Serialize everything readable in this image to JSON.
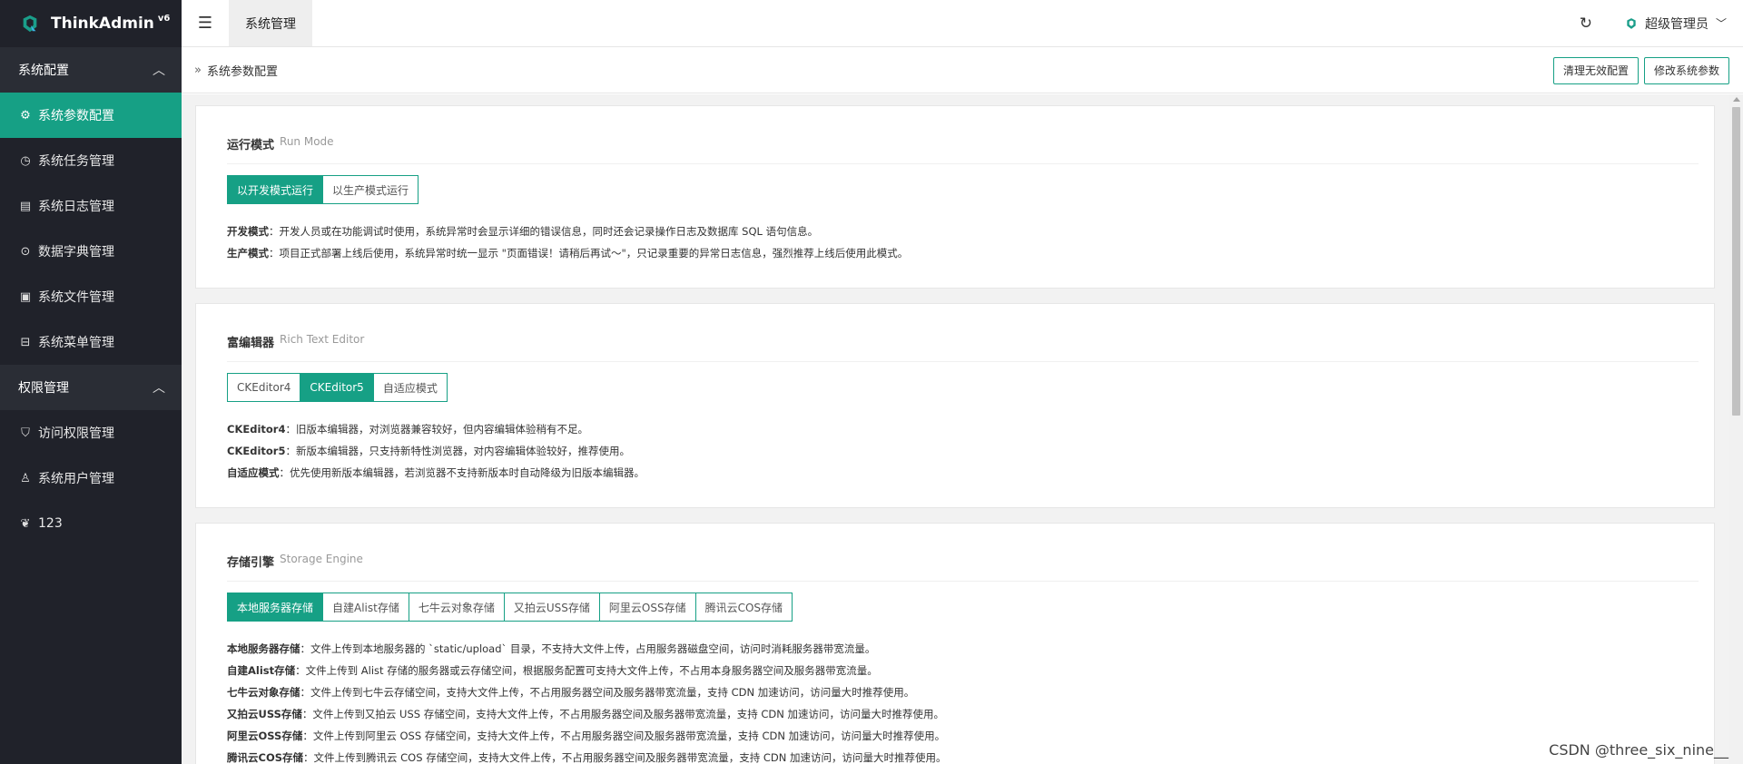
{
  "app": {
    "name": "ThinkAdmin",
    "version": "v6"
  },
  "sidebar": {
    "groups": [
      {
        "title": "系统配置",
        "items": [
          {
            "label": "系统参数配置",
            "icon": "gear-icon",
            "active": true
          },
          {
            "label": "系统任务管理",
            "icon": "clock-icon"
          },
          {
            "label": "系统日志管理",
            "icon": "log-icon"
          },
          {
            "label": "数据字典管理",
            "icon": "dictionary-icon"
          },
          {
            "label": "系统文件管理",
            "icon": "image-icon"
          },
          {
            "label": "系统菜单管理",
            "icon": "menu-icon"
          }
        ]
      },
      {
        "title": "权限管理",
        "items": [
          {
            "label": "访问权限管理",
            "icon": "shield-icon"
          },
          {
            "label": "系统用户管理",
            "icon": "user-icon"
          },
          {
            "label": "123",
            "icon": "leaf-icon"
          }
        ]
      }
    ]
  },
  "topbar": {
    "tab_label": "系统管理",
    "user_name": "超级管理员"
  },
  "breadcrumb": {
    "title": "系统参数配置",
    "actions": [
      "清理无效配置",
      "修改系统参数"
    ]
  },
  "sections": {
    "run_mode": {
      "title": "运行模式",
      "subtitle": "Run Mode",
      "options": [
        "以开发模式运行",
        "以生产模式运行"
      ],
      "selected": "以开发模式运行",
      "desc": [
        {
          "label": "开发模式",
          "text": "：开发人员或在功能调试时使用，系统异常时会显示详细的错误信息，同时还会记录操作日志及数据库 SQL 语句信息。"
        },
        {
          "label": "生产模式",
          "text": "：项目正式部署上线后使用，系统异常时统一显示 \"页面错误！请稍后再试～\"，只记录重要的异常日志信息，强烈推荐上线后使用此模式。"
        }
      ]
    },
    "editor": {
      "title": "富编辑器",
      "subtitle": "Rich Text Editor",
      "options": [
        "CKEditor4",
        "CKEditor5",
        "自适应模式"
      ],
      "selected": "CKEditor5",
      "desc": [
        {
          "label": "CKEditor4",
          "text": "：旧版本编辑器，对浏览器兼容较好，但内容编辑体验稍有不足。"
        },
        {
          "label": "CKEditor5",
          "text": "：新版本编辑器，只支持新特性浏览器，对内容编辑体验较好，推荐使用。"
        },
        {
          "label": "自适应模式",
          "text": "：优先使用新版本编辑器，若浏览器不支持新版本时自动降级为旧版本编辑器。"
        }
      ]
    },
    "storage": {
      "title": "存储引擎",
      "subtitle": "Storage Engine",
      "options": [
        "本地服务器存储",
        "自建Alist存储",
        "七牛云对象存储",
        "又拍云USS存储",
        "阿里云OSS存储",
        "腾讯云COS存储"
      ],
      "selected": "本地服务器存储",
      "desc": [
        {
          "label": "本地服务器存储",
          "text": "：文件上传到本地服务器的 `static/upload` 目录，不支持大文件上传，占用服务器磁盘空间，访问时消耗服务器带宽流量。"
        },
        {
          "label": "自建Alist存储",
          "text": "：文件上传到 Alist 存储的服务器或云存储空间，根据服务配置可支持大文件上传，不占用本身服务器空间及服务器带宽流量。"
        },
        {
          "label": "七牛云对象存储",
          "text": "：文件上传到七牛云存储空间，支持大文件上传，不占用服务器空间及服务器带宽流量，支持 CDN 加速访问，访问量大时推荐使用。"
        },
        {
          "label": "又拍云USS存储",
          "text": "：文件上传到又拍云 USS 存储空间，支持大文件上传，不占用服务器空间及服务器带宽流量，支持 CDN 加速访问，访问量大时推荐使用。"
        },
        {
          "label": "阿里云OSS存储",
          "text": "：文件上传到阿里云 OSS 存储空间，支持大文件上传，不占用服务器空间及服务器带宽流量，支持 CDN 加速访问，访问量大时推荐使用。"
        },
        {
          "label": "腾讯云COS存储",
          "text": "：文件上传到腾讯云 COS 存储空间，支持大文件上传，不占用服务器空间及服务器带宽流量，支持 CDN 加速访问，访问量大时推荐使用。"
        }
      ]
    }
  },
  "watermark": "CSDN @three_six_nine__",
  "colors": {
    "accent": "#16a085",
    "sidebar_bg": "#20222a",
    "sidebar_group_bg": "#2a2d35",
    "content_bg": "#f2f2f2"
  }
}
